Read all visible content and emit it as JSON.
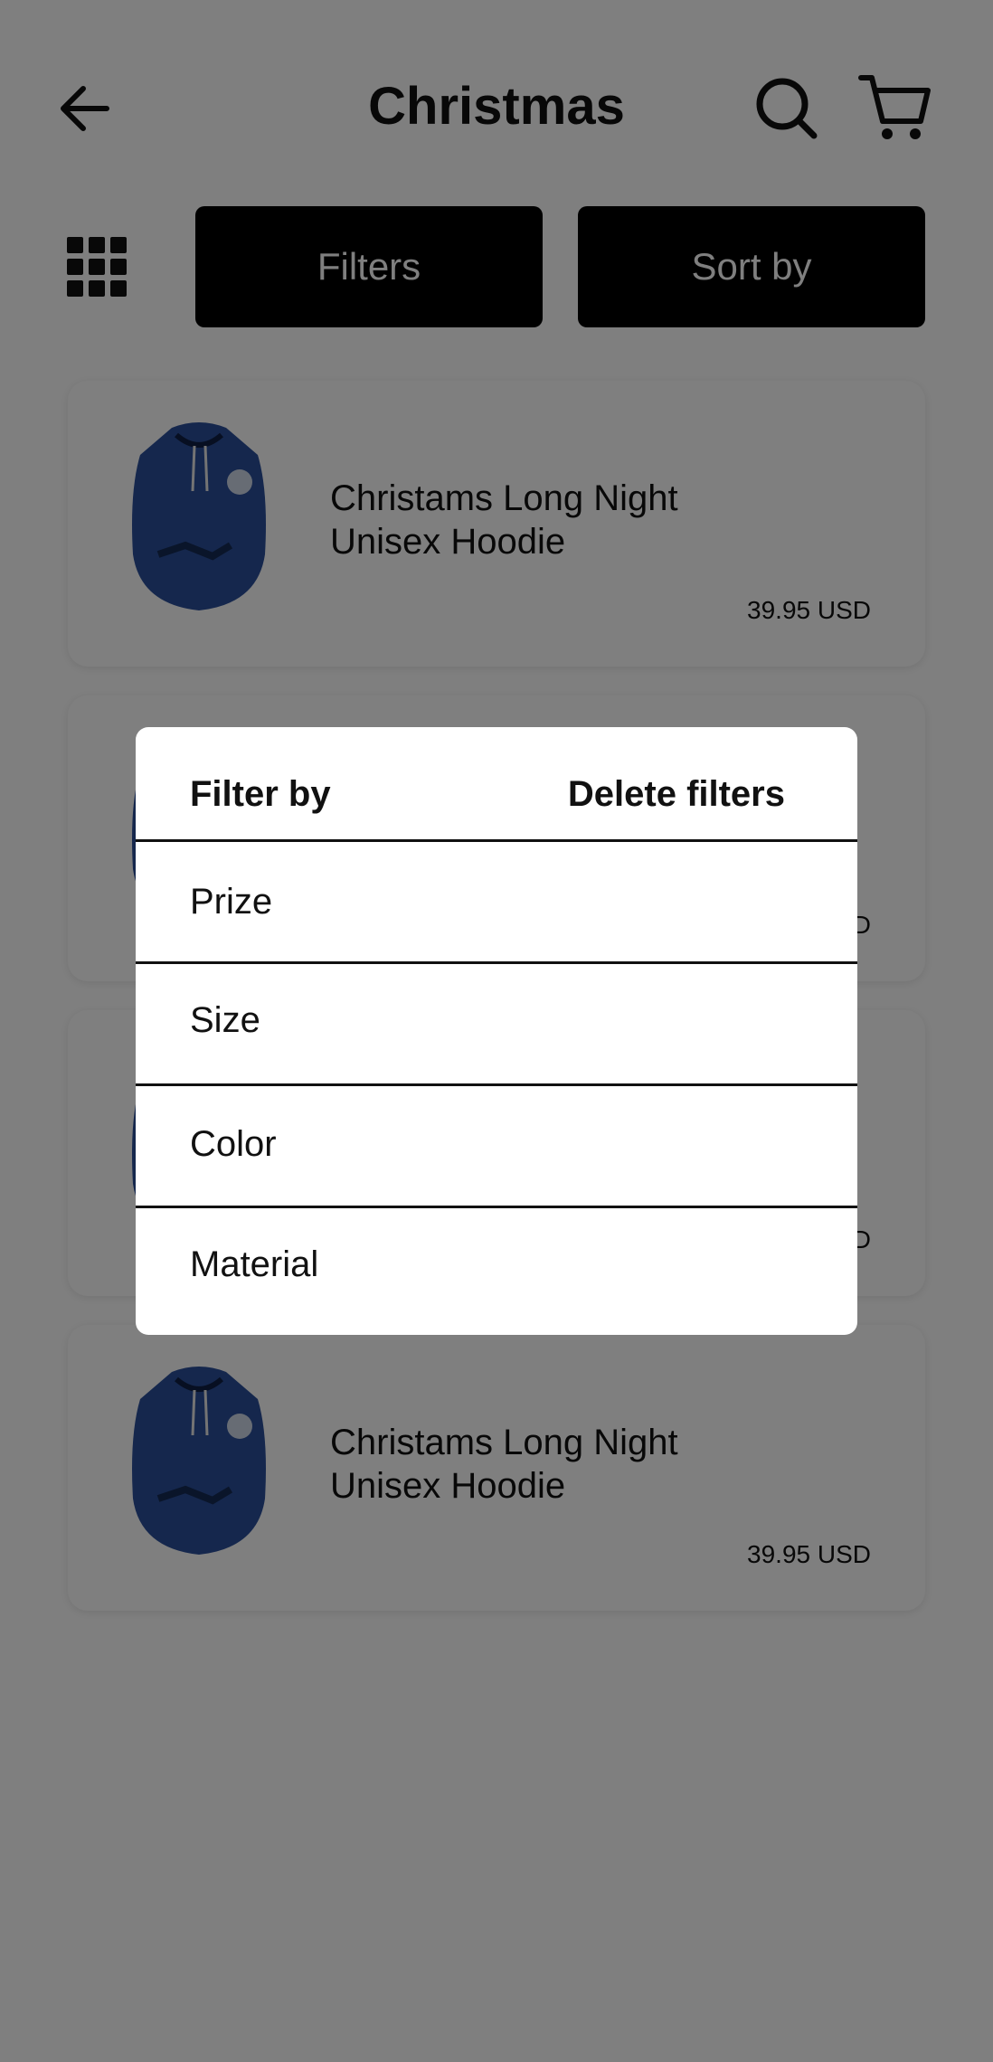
{
  "header": {
    "title": "Christmas",
    "back_icon": "arrow-left-icon",
    "search_icon": "search-icon",
    "cart_icon": "cart-icon"
  },
  "toolbar": {
    "grid_icon": "grid-view-icon",
    "filters_label": "Filters",
    "sort_label": "Sort by"
  },
  "products": [
    {
      "name_line1": "Christams Long Night",
      "name_line2": "Unisex Hoodie",
      "price": "39.95 USD"
    },
    {
      "name_line1": "",
      "name_line2": "",
      "price": "D"
    },
    {
      "name_line1": "",
      "name_line2": "",
      "price": "D"
    },
    {
      "name_line1": "Christams Long Night",
      "name_line2": "Unisex Hoodie",
      "price": "39.95 USD"
    }
  ],
  "filter_modal": {
    "title": "Filter by",
    "delete_label": "Delete filters",
    "options": [
      "Prize",
      "Size",
      "Color",
      "Material"
    ]
  },
  "colors": {
    "button_bg": "#000000",
    "scrim": "rgba(0,0,0,0.5)",
    "hoodie_blue": "#2a4f9a"
  }
}
